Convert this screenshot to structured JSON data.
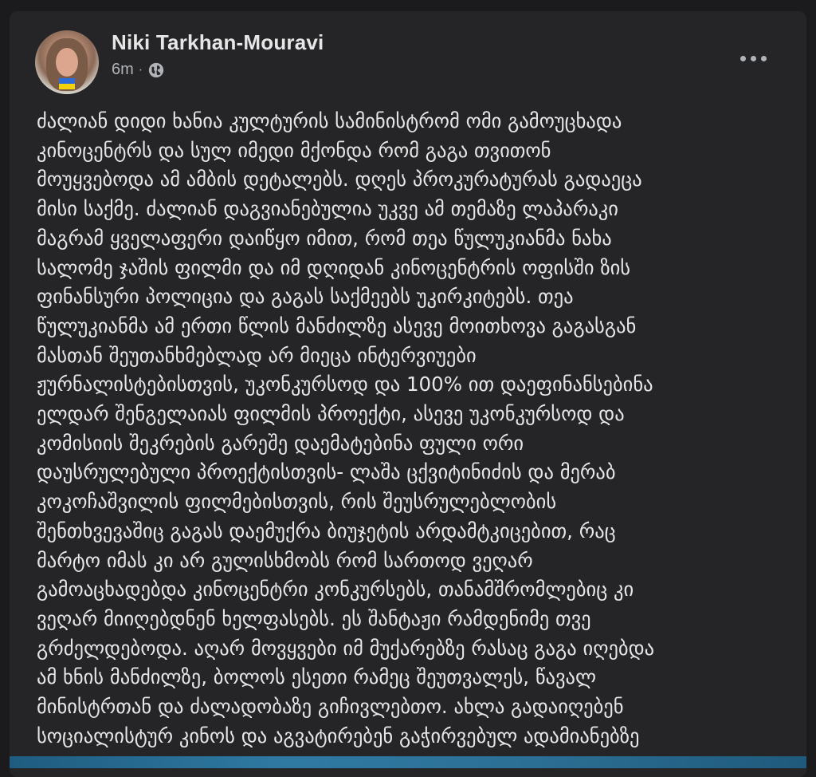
{
  "post": {
    "author": "Niki Tarkhan-Mouravi",
    "time": "6m",
    "separator": "·",
    "privacy_icon": "globe-icon",
    "more_icon": "more-horizontal-icon",
    "avatar_badge": "ukraine-flag",
    "text_lines": [
      "ძალიან დიდი ხანია კულტურის სამინისტრომ ომი გამოუცხადა",
      "კინოცენტრს და სულ იმედი მქონდა რომ გაგა თვითონ",
      "მოუყვებოდა ამ ამბის დეტალებს. დღეს პროკურატურას გადაეცა",
      "მისი საქმე. ძალიან დაგვიანებულია უკვე ამ თემაზე ლაპარაკი",
      "მაგრამ ყველაფერი დაიწყო იმით, რომ თეა წულუკიანმა ნახა",
      "სალომე ჯაშის ფილმი და იმ დღიდან კინოცენტრის ოფისში ზის",
      "ფინანსური პოლიცია და გაგას საქმეებს უკირკიტებს. თეა",
      "წულუკიანმა ამ ერთი წლის მანძილზე ასევე მოითხოვა გაგასგან",
      "მასთან შეუთანხმებლად არ მიეცა ინტერვიუები",
      "ჟურნალისტებისთვის, უკონკურსოდ და 100% ით დაეფინანსებინა",
      "ელდარ შენგელაიას ფილმის პროექტი, ასევე უკონკურსოდ და",
      "კომისიის შეკრების გარეშე დაემატებინა ფული ორი",
      "დაუსრულებული პროექტისთვის- ლაშა ცქვიტინიძის და მერაბ",
      "კოკოჩაშვილის ფილმებისთვის, რის შეუსრულებლობის",
      "შენთხვევაშიც გაგას დაემუქრა ბიუჯეტის არდამტკიცებით, რაც",
      "მარტო იმას კი არ გულისხმობს რომ სართოდ ვეღარ",
      "გამოაცხადებდა კინოცენტრი კონკურსებს, თანამშრომლებიც კი",
      "ვეღარ მიიღებდნენ ხელფასებს. ეს შანტაჟი რამდენიმე თვე",
      "გრძელდებოდა. აღარ მოვყვები იმ მუქარებზე რასაც გაგა იღებდა",
      "ამ ხნის მანძილზე, ბოლოს ესეთი რამეც შეუთვალეს, წავალ",
      "მინისტრთან და ძალადობაზე გიჩივლებთო. ახლა გადაიღებენ",
      "სოციალისტურ კინოს და აგვატირებენ გაჭირვებულ ადამიანებზე"
    ]
  }
}
